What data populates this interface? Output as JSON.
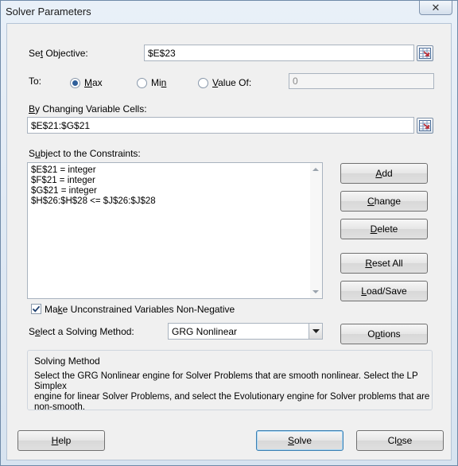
{
  "window": {
    "title": "Solver Parameters",
    "close_glyph": "✕"
  },
  "objective": {
    "label_pre": "Se",
    "label_acc": "t",
    "label_post": " Objective:",
    "value": "$E$23"
  },
  "to": {
    "label": "To:",
    "options": [
      {
        "pre": "",
        "acc": "M",
        "post": "ax",
        "selected": true
      },
      {
        "pre": "Mi",
        "acc": "n",
        "post": "",
        "selected": false
      },
      {
        "pre": "",
        "acc": "V",
        "post": "alue Of:",
        "selected": false
      }
    ],
    "value_of": "0"
  },
  "changing": {
    "label_pre": "",
    "label_acc": "B",
    "label_post": "y Changing Variable Cells:",
    "value": "$E$21:$G$21"
  },
  "constraints": {
    "label_pre": "S",
    "label_acc": "u",
    "label_post": "bject to the Constraints:",
    "items": [
      "$E$21 = integer",
      "$F$21 = integer",
      "$G$21 = integer",
      "$H$26:$H$28 <= $J$26:$J$28"
    ]
  },
  "side_buttons": {
    "add": {
      "pre": "",
      "acc": "A",
      "post": "dd"
    },
    "change": {
      "pre": "",
      "acc": "C",
      "post": "hange"
    },
    "delete": {
      "pre": "",
      "acc": "D",
      "post": "elete"
    },
    "reset_all": {
      "pre": "",
      "acc": "R",
      "post": "eset All"
    },
    "load_save": {
      "pre": "",
      "acc": "L",
      "post": "oad/Save"
    },
    "options": {
      "pre": "O",
      "acc": "p",
      "post": "tions"
    }
  },
  "nonneg": {
    "checked": true,
    "pre": "Ma",
    "acc": "k",
    "post": "e Unconstrained Variables Non-Negative"
  },
  "method": {
    "label_pre": "S",
    "label_acc": "e",
    "label_post": "lect a Solving Method:",
    "selected": "GRG Nonlinear"
  },
  "solving_method": {
    "title": "Solving Method",
    "lines": [
      "Select the GRG Nonlinear engine for Solver Problems that are smooth nonlinear. Select the LP Simplex",
      "engine for linear Solver Problems, and select the Evolutionary engine for Solver problems that are",
      "non-smooth."
    ]
  },
  "bottom_buttons": {
    "help": {
      "pre": "",
      "acc": "H",
      "post": "elp"
    },
    "solve": {
      "pre": "",
      "acc": "S",
      "post": "olve"
    },
    "close": {
      "pre": "Cl",
      "acc": "o",
      "post": "se"
    }
  },
  "colors": {
    "radio_dot": "#2f5f9a",
    "default_button_border": "#3c7fb1"
  },
  "icons": {
    "cell_reference": "range-select-icon",
    "checkmark": "checkmark-icon",
    "dropdown": "chevron-down-icon"
  }
}
